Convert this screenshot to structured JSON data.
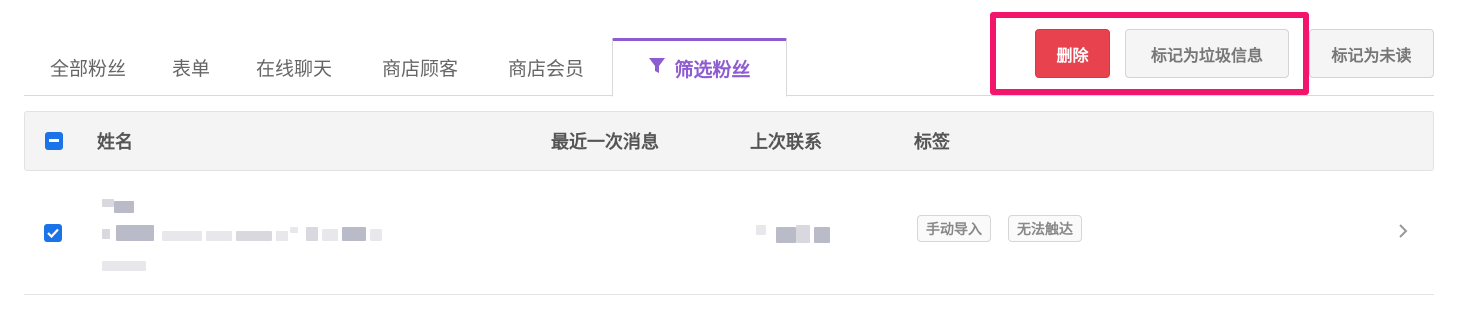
{
  "tabs": [
    {
      "label": "全部粉丝"
    },
    {
      "label": "表单"
    },
    {
      "label": "在线聊天"
    },
    {
      "label": "商店顾客"
    },
    {
      "label": "商店会员"
    },
    {
      "label": "筛选粉丝",
      "icon": "filter-icon",
      "active": true
    }
  ],
  "actions": {
    "delete_label": "删除",
    "mark_spam_label": "标记为垃圾信息",
    "mark_unread_label": "标记为未读"
  },
  "table": {
    "columns": [
      "姓名",
      "最近一次消息",
      "上次联系",
      "标签"
    ],
    "select_all_state": "indeterminate",
    "rows": [
      {
        "selected": true,
        "name": "",
        "last_message": "",
        "last_contact": "",
        "tags": [
          "手动导入",
          "无法触达"
        ]
      }
    ]
  },
  "colors": {
    "accent": "#8e5cd1",
    "danger": "#e8424e",
    "highlight": "#f2156b",
    "checkbox": "#1a73e8"
  }
}
